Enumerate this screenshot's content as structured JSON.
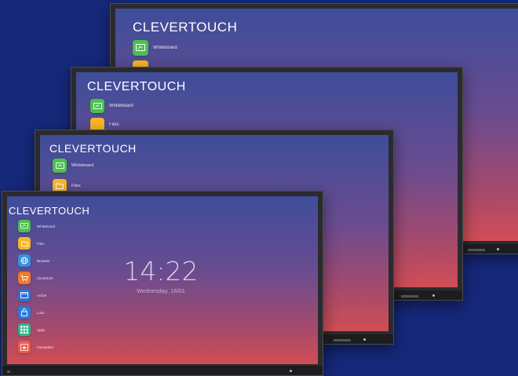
{
  "brand": "CLEVERTOUCH",
  "apps": [
    {
      "label": "Whiteboard",
      "icon": "whiteboard-icon",
      "color": "#4cbf4f"
    },
    {
      "label": "Files",
      "icon": "folder-icon",
      "color": "#f7b728"
    },
    {
      "label": "Browser",
      "icon": "globe-icon",
      "color": "#3a8fe0"
    },
    {
      "label": "Clevertore",
      "icon": "cart-icon",
      "color": "#f0782a"
    },
    {
      "label": "Active",
      "icon": "window-icon",
      "color": "#2f6fd0"
    },
    {
      "label": "Lock",
      "icon": "lock-icon",
      "color": "#2a7ad8"
    },
    {
      "label": "Apps",
      "icon": "grid-icon",
      "color": "#2fb58c"
    },
    {
      "label": "Favourites",
      "icon": "star-icon",
      "color": "#ef5a4e"
    }
  ],
  "clock": {
    "time": "14:22",
    "date": "Wednesday, 16/01"
  },
  "colors": {
    "background": "#16287a",
    "bezel": "#2b2b2e"
  }
}
